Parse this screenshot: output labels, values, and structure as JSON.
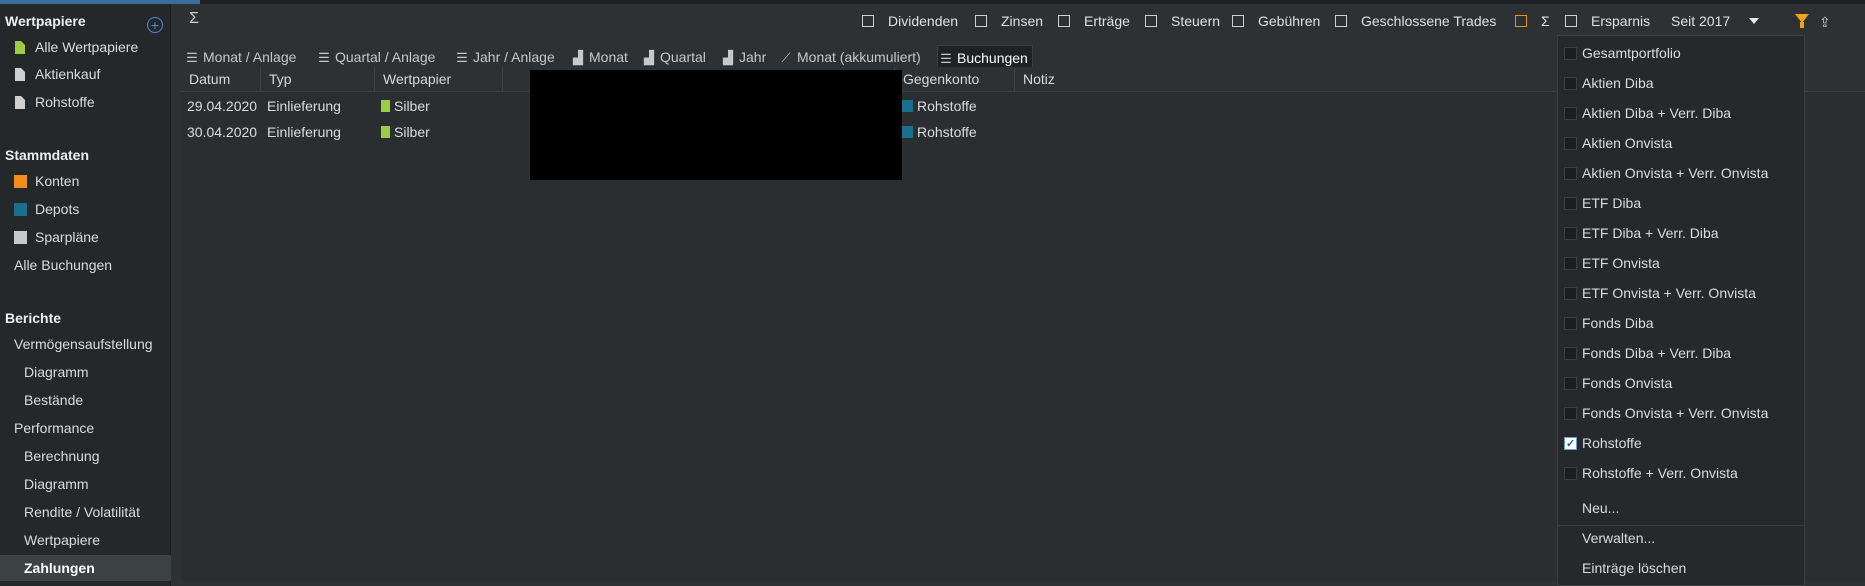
{
  "sidebar": {
    "sections": [
      {
        "title": "Wertpapiere"
      },
      {
        "title": "Stammdaten"
      },
      {
        "title": "Berichte"
      }
    ],
    "items": {
      "alle_wertpapiere": "Alle Wertpapiere",
      "aktienkauf": "Aktienkauf",
      "rohstoffe": "Rohstoffe",
      "konten": "Konten",
      "depots": "Depots",
      "sparplaene": "Sparpläne",
      "alle_buchungen": "Alle Buchungen",
      "vermoegen": "Vermögensaufstellung",
      "v_diagramm": "Diagramm",
      "v_bestaende": "Bestände",
      "performance": "Performance",
      "p_berechnung": "Berechnung",
      "p_diagramm": "Diagramm",
      "p_rendite": "Rendite / Volatilität",
      "p_wertpapiere": "Wertpapiere",
      "p_zahlungen": "Zahlungen"
    }
  },
  "toolbar": {
    "sigma": "Σ",
    "filters": {
      "dividenden": "Dividenden",
      "zinsen": "Zinsen",
      "ertraege": "Erträge",
      "steuern": "Steuern",
      "gebuehren": "Gebühren",
      "geschlossene": "Geschlossene Trades",
      "sigma2": "Σ",
      "ersparnis": "Ersparnis"
    },
    "period": "Seit 2017",
    "accent_color": "#f0a21b"
  },
  "tabs": {
    "monat_anlage": "Monat / Anlage",
    "quartal_anlage": "Quartal / Anlage",
    "jahr_anlage": "Jahr / Anlage",
    "monat": "Monat",
    "quartal": "Quartal",
    "jahr": "Jahr",
    "monat_akk": "Monat (akkumuliert)",
    "buchungen": "Buchungen"
  },
  "table": {
    "headers": {
      "datum": "Datum",
      "typ": "Typ",
      "wertpapier": "Wertpapier",
      "gegenkonto": "Gegenkonto",
      "notiz": "Notiz"
    },
    "rows": [
      {
        "datum": "29.04.2020",
        "typ": "Einlieferung",
        "wertpapier": "Silber",
        "gegenkonto": "Rohstoffe"
      },
      {
        "datum": "30.04.2020",
        "typ": "Einlieferung",
        "wertpapier": "Silber",
        "gegenkonto": "Rohstoffe"
      }
    ]
  },
  "dropdown": {
    "options": [
      {
        "label": "Gesamtportfolio",
        "checked": false
      },
      {
        "label": "Aktien Diba",
        "checked": false
      },
      {
        "label": "Aktien Diba + Verr. Diba",
        "checked": false
      },
      {
        "label": "Aktien Onvista",
        "checked": false
      },
      {
        "label": "Aktien Onvista + Verr. Onvista",
        "checked": false
      },
      {
        "label": "ETF Diba",
        "checked": false
      },
      {
        "label": "ETF Diba + Verr. Diba",
        "checked": false
      },
      {
        "label": "ETF Onvista",
        "checked": false
      },
      {
        "label": "ETF Onvista + Verr. Onvista",
        "checked": false
      },
      {
        "label": "Fonds Diba",
        "checked": false
      },
      {
        "label": "Fonds Diba + Verr. Diba",
        "checked": false
      },
      {
        "label": "Fonds Onvista",
        "checked": false
      },
      {
        "label": "Fonds Onvista + Verr. Onvista",
        "checked": false
      },
      {
        "label": "Rohstoffe",
        "checked": true
      },
      {
        "label": "Rohstoffe + Verr. Onvista",
        "checked": false
      }
    ],
    "actions": {
      "neu": "Neu...",
      "verwalten": "Verwalten...",
      "loeschen": "Einträge löschen"
    }
  }
}
